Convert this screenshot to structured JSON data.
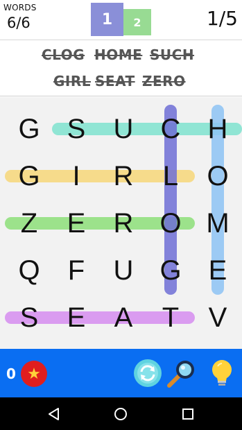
{
  "header": {
    "words_label": "WORDS",
    "words_count": "6/6",
    "pages": [
      "1",
      "2"
    ],
    "level": "1/5"
  },
  "word_list": [
    "CLOG",
    "HOME",
    "SUCH",
    "GIRL",
    "SEAT",
    "ZERO"
  ],
  "grid": {
    "rows": [
      [
        "G",
        "S",
        "U",
        "C",
        "H"
      ],
      [
        "G",
        "I",
        "R",
        "L",
        "O"
      ],
      [
        "Z",
        "E",
        "R",
        "O",
        "M"
      ],
      [
        "Q",
        "F",
        "U",
        "G",
        "E"
      ],
      [
        "S",
        "E",
        "A",
        "T",
        "V"
      ]
    ]
  },
  "found_words": [
    {
      "word": "SUCH",
      "from": [
        0,
        1
      ],
      "to": [
        0,
        4
      ],
      "color": "#7fe3cf"
    },
    {
      "word": "GIRL",
      "from": [
        1,
        0
      ],
      "to": [
        1,
        3
      ],
      "color": "#f7d77a"
    },
    {
      "word": "ZERO",
      "from": [
        2,
        0
      ],
      "to": [
        2,
        3
      ],
      "color": "#8ee07a"
    },
    {
      "word": "CLOG",
      "from": [
        0,
        3
      ],
      "to": [
        3,
        3
      ],
      "color": "#6f6fd6"
    },
    {
      "word": "HOME",
      "from": [
        0,
        4
      ],
      "to": [
        3,
        4
      ],
      "color": "#8ec4f5"
    },
    {
      "word": "SEAT",
      "from": [
        4,
        0
      ],
      "to": [
        4,
        3
      ],
      "color": "#d68ef0"
    }
  ],
  "toolbar": {
    "coins": "0",
    "icons": [
      "star-icon",
      "shuffle-icon",
      "magnifier-icon",
      "lightbulb-icon"
    ]
  },
  "colors": {
    "toolbar_bg": "#0a6ef2",
    "page_active": "#8a8fd8",
    "page_next": "#98db93"
  }
}
